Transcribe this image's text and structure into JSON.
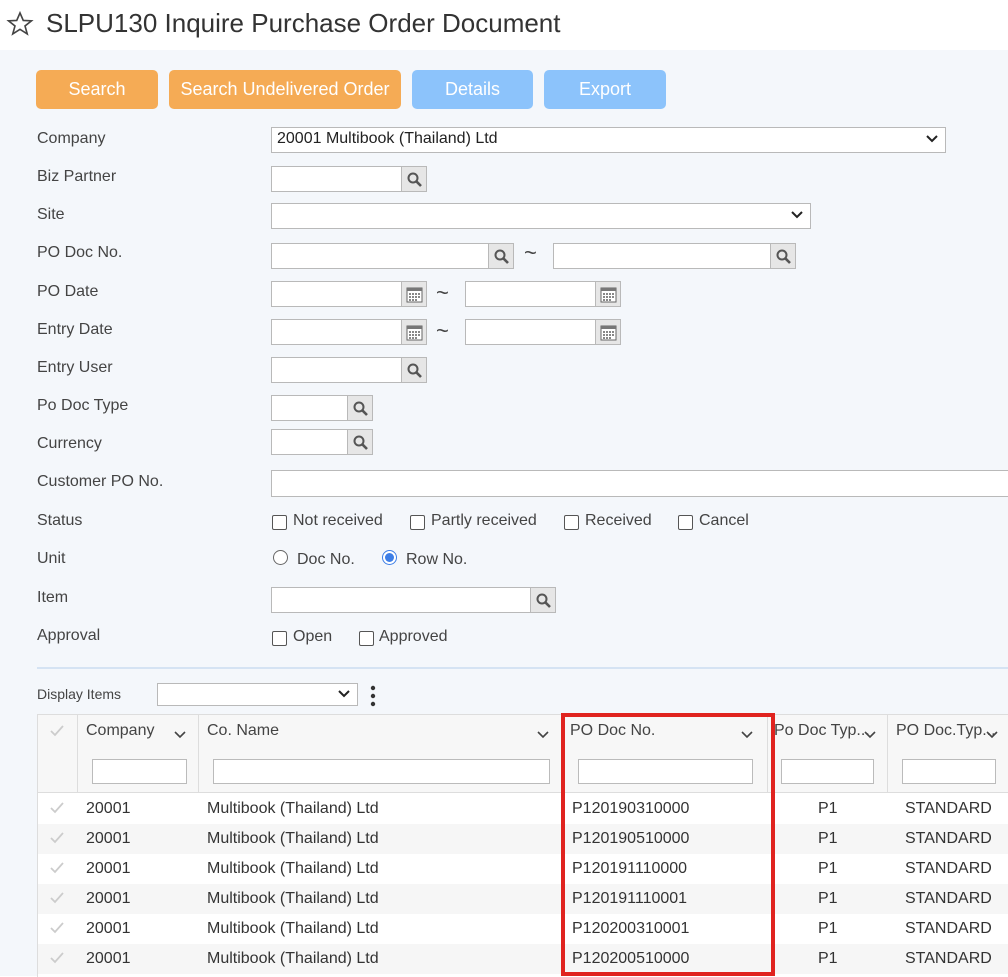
{
  "header": {
    "title": "SLPU130 Inquire Purchase Order Document",
    "icon": "star-outline-icon"
  },
  "toolbar": {
    "search_label": "Search",
    "search_undelivered_label": "Search Undelivered Order",
    "details_label": "Details",
    "export_label": "Export"
  },
  "colors": {
    "orange": "#f5ab55",
    "blue": "#8cc3fb",
    "highlight": "#e0231f",
    "radio": "#3d7ee6"
  },
  "form": {
    "company_label": "Company",
    "company_value": "20001 Multibook (Thailand) Ltd",
    "biz_partner_label": "Biz Partner",
    "site_label": "Site",
    "po_doc_no_label": "PO Doc No.",
    "po_date_label": "PO Date",
    "entry_date_label": "Entry Date",
    "entry_user_label": "Entry User",
    "po_doc_type_label": "Po Doc Type",
    "currency_label": "Currency",
    "customer_po_label": "Customer PO No.",
    "status_label": "Status",
    "status_options": [
      "Not received",
      "Partly received",
      "Received",
      "Cancel"
    ],
    "unit_label": "Unit",
    "unit_options": [
      "Doc No.",
      "Row No."
    ],
    "unit_selected": "Row No.",
    "item_label": "Item",
    "approval_label": "Approval",
    "approval_options": [
      "Open",
      "Approved"
    ],
    "range_separator": "~"
  },
  "display": {
    "label": "Display Items"
  },
  "grid": {
    "columns": [
      "Company",
      "Co. Name",
      "PO Doc No.",
      "Po Doc Typ...",
      "PO Doc.Typ..."
    ],
    "rows": [
      [
        "20001",
        "Multibook (Thailand) Ltd",
        "P120190310000",
        "P1",
        "STANDARD"
      ],
      [
        "20001",
        "Multibook (Thailand) Ltd",
        "P120190510000",
        "P1",
        "STANDARD"
      ],
      [
        "20001",
        "Multibook (Thailand) Ltd",
        "P120191110000",
        "P1",
        "STANDARD"
      ],
      [
        "20001",
        "Multibook (Thailand) Ltd",
        "P120191110001",
        "P1",
        "STANDARD"
      ],
      [
        "20001",
        "Multibook (Thailand) Ltd",
        "P120200310001",
        "P1",
        "STANDARD"
      ],
      [
        "20001",
        "Multibook (Thailand) Ltd",
        "P120200510000",
        "P1",
        "STANDARD"
      ]
    ]
  }
}
